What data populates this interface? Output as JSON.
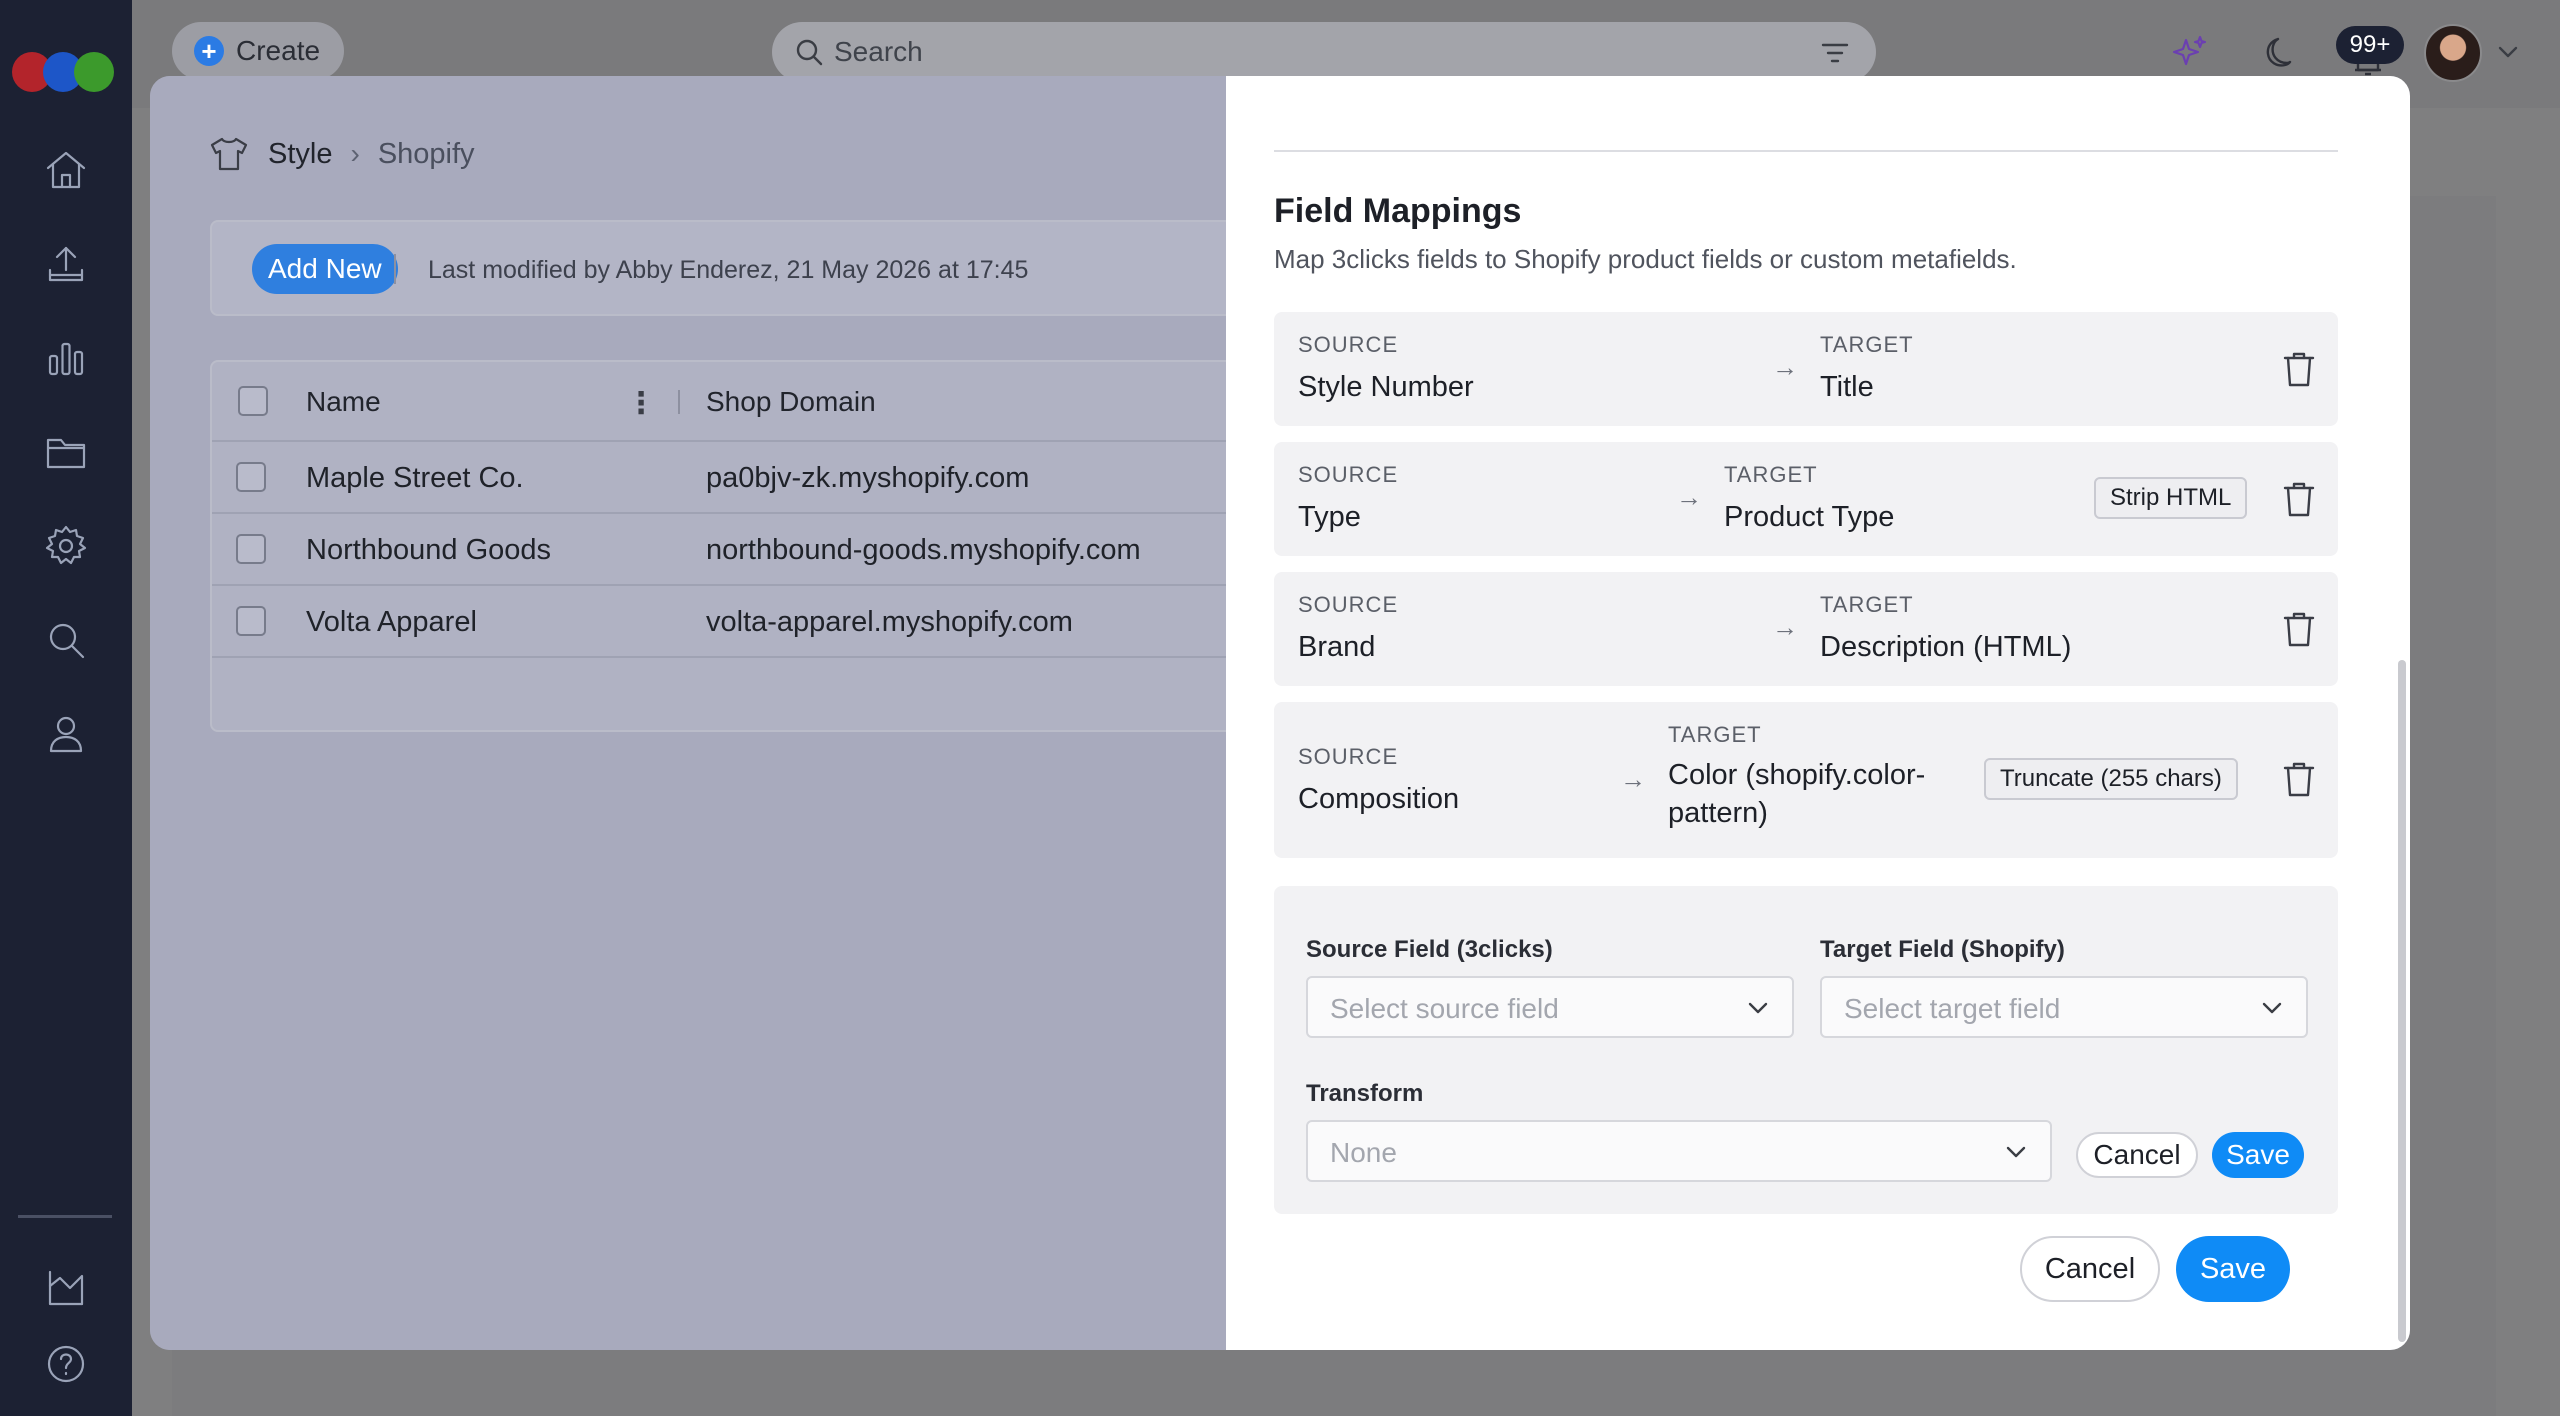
{
  "topbar": {
    "create_label": "Create",
    "search_placeholder": "Search",
    "notifications_count": "99+"
  },
  "breadcrumb": {
    "root": "Style",
    "current": "Shopify"
  },
  "toolbar": {
    "add_new_label": "Add New",
    "last_modified": "Last modified by Abby Enderez, 21 May 2026 at 17:45"
  },
  "table": {
    "columns": [
      "Name",
      "Shop Domain"
    ],
    "rows": [
      {
        "name": "Maple Street Co.",
        "domain": "pa0bjv-zk.myshopify.com"
      },
      {
        "name": "Northbound Goods",
        "domain": "northbound-goods.myshopify.com"
      },
      {
        "name": "Volta Apparel",
        "domain": "volta-apparel.myshopify.com"
      }
    ]
  },
  "field_mappings": {
    "title": "Field Mappings",
    "subtitle": "Map 3clicks fields to Shopify product fields or custom metafields.",
    "source_label": "SOURCE",
    "target_label": "TARGET",
    "rows": [
      {
        "source": "Style Number",
        "target": "Title",
        "transform": ""
      },
      {
        "source": "Type",
        "target": "Product Type",
        "transform": "Strip HTML"
      },
      {
        "source": "Brand",
        "target": "Description (HTML)",
        "transform": ""
      },
      {
        "source": "Composition",
        "target": "Color (shopify.color-pattern)",
        "transform": "Truncate (255 chars)"
      }
    ]
  },
  "editor": {
    "source_field_label": "Source Field (3clicks)",
    "target_field_label": "Target Field (Shopify)",
    "source_placeholder": "Select source field",
    "target_placeholder": "Select target field",
    "transform_label": "Transform",
    "transform_value": "None",
    "cancel_label": "Cancel",
    "save_label": "Save"
  },
  "footer": {
    "cancel_label": "Cancel",
    "save_label": "Save"
  },
  "colors": {
    "primary": "#0f8bf6",
    "rail": "#1c2133",
    "add_new": "#2f7fdf"
  },
  "icons": [
    "home-icon",
    "upload-icon",
    "chart-icon",
    "folder-icon",
    "gear-icon",
    "search-icon",
    "user-icon",
    "analytics-icon",
    "help-icon",
    "sparkle-icon",
    "moon-icon",
    "bell-icon",
    "tshirt-icon",
    "trash-icon",
    "chevron-down-icon"
  ]
}
